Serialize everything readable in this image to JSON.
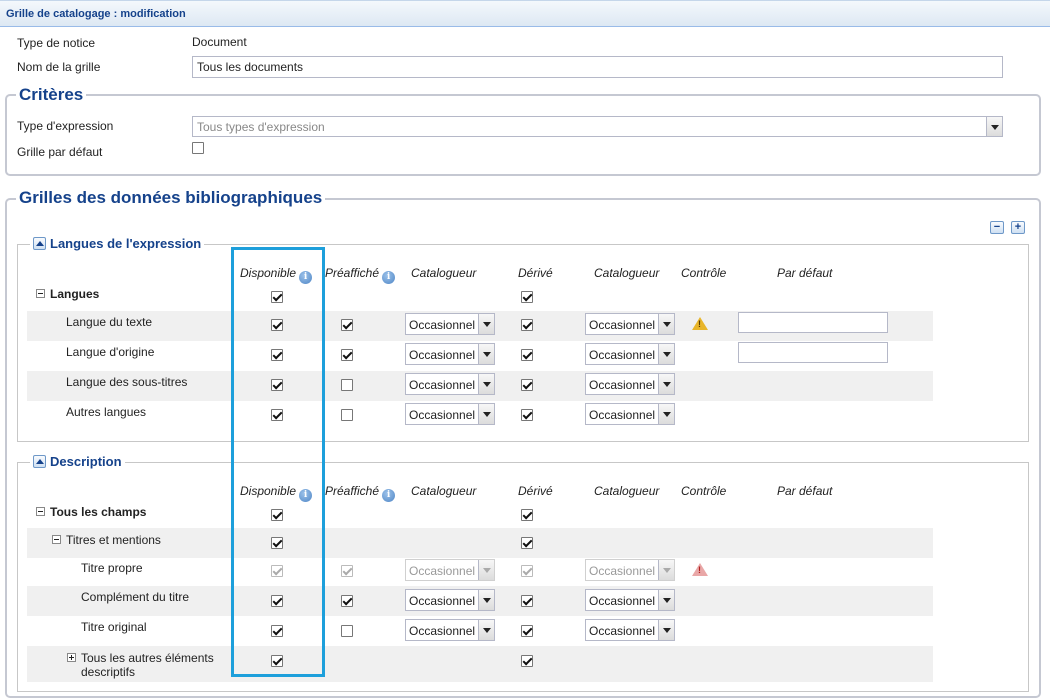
{
  "window": {
    "title": "Grille de catalogage : modification"
  },
  "general": {
    "type_notice_label": "Type de notice",
    "type_notice_value": "Document",
    "nom_grille_label": "Nom de la grille",
    "nom_grille_value": "Tous les documents"
  },
  "criteres": {
    "legend": "Critères",
    "type_expression_label": "Type d'expression",
    "type_expression_placeholder": "Tous types d'expression",
    "grille_defaut_label": "Grille par défaut",
    "grille_defaut_checked": false
  },
  "grilles": {
    "legend": "Grilles des données bibliographiques",
    "collapse_all": "−",
    "expand_all": "+",
    "columns": {
      "disponible": "Disponible",
      "preaffiche": "Préaffiché",
      "catalogueur1": "Catalogueur",
      "derive": "Dérivé",
      "catalogueur2": "Catalogueur",
      "controle": "Contrôle",
      "par_defaut": "Par défaut"
    },
    "info_icon": "i",
    "sections": [
      {
        "title": "Langues de l'expression",
        "group_label": "Langues",
        "rows": [
          {
            "label": "Langue du texte",
            "disponible": true,
            "preaffiche": true,
            "cat1": "Occasionnel",
            "derive": true,
            "cat2": "Occasionnel",
            "controle": "warning",
            "default_field": true
          },
          {
            "label": "Langue d'origine",
            "disponible": true,
            "preaffiche": true,
            "cat1": "Occasionnel",
            "derive": true,
            "cat2": "Occasionnel",
            "controle": "",
            "default_field": true
          },
          {
            "label": "Langue des sous-titres",
            "disponible": true,
            "preaffiche": false,
            "cat1": "Occasionnel",
            "derive": true,
            "cat2": "Occasionnel",
            "controle": "",
            "default_field": false
          },
          {
            "label": "Autres langues",
            "disponible": true,
            "preaffiche": false,
            "cat1": "Occasionnel",
            "derive": true,
            "cat2": "Occasionnel",
            "controle": "",
            "default_field": false
          }
        ]
      },
      {
        "title": "Description",
        "group_label": "Tous les champs",
        "subgroup_label": "Titres et mentions",
        "rows": [
          {
            "label": "Titre propre",
            "disponible": true,
            "preaffiche": true,
            "cat1": "Occasionnel",
            "derive": true,
            "cat2": "Occasionnel",
            "controle": "error",
            "disabled": true
          },
          {
            "label": "Complément du titre",
            "disponible": true,
            "preaffiche": true,
            "cat1": "Occasionnel",
            "derive": true,
            "cat2": "Occasionnel",
            "controle": ""
          },
          {
            "label": "Titre original",
            "disponible": true,
            "preaffiche": false,
            "cat1": "Occasionnel",
            "derive": true,
            "cat2": "Occasionnel",
            "controle": ""
          }
        ],
        "other_label_line1": "Tous les autres éléments",
        "other_label_line2": "descriptifs"
      }
    ]
  },
  "colors": {
    "accent": "#15428b",
    "highlight": "#1d9fdb"
  }
}
